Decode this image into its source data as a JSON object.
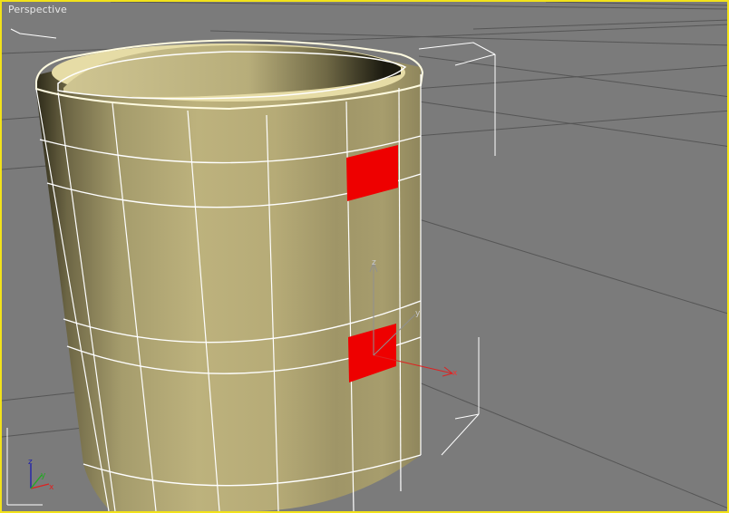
{
  "viewport": {
    "label": "Perspective",
    "border_color": "#f2e21a",
    "background_color": "#7b7b7b"
  },
  "scene": {
    "object": "cylinder-mug",
    "mesh_color": "#c8bd88",
    "wire_color": "#ffffff",
    "selected_face_color": "#ee0000",
    "grid_color": "#555555"
  },
  "gizmo": {
    "x_label": "x",
    "y_label": "y",
    "z_label": "z"
  },
  "axis_tripod": {
    "x_label": "x",
    "y_label": "y",
    "z_label": "z"
  }
}
